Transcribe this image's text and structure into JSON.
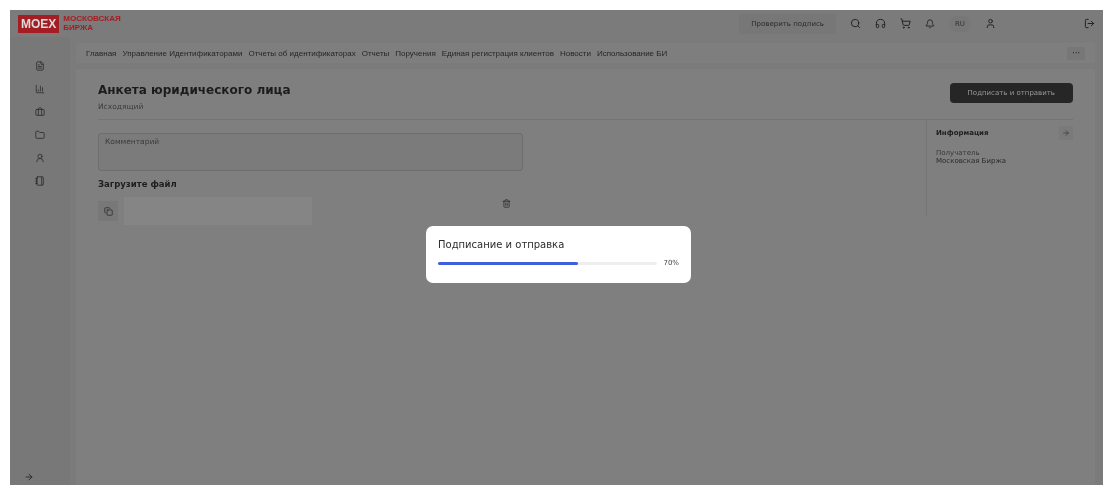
{
  "header": {
    "logo": "MOEX",
    "logo_caption": "МОСКОВСКАЯ БИРЖА",
    "verify_button": "Проверить подпись",
    "language": "RU"
  },
  "nav": {
    "items": [
      "Главная",
      "Управление Идентификаторами",
      "Отчеты об идентификаторах",
      "Отчеты",
      "Поручения",
      "Единая регистрация клиентов",
      "Новости",
      "Использование БИ"
    ],
    "more": "···"
  },
  "document": {
    "title": "Анкета юридического лица",
    "subtitle": "Исходящий",
    "submit_button": "Подписать и отправить",
    "comment": {
      "placeholder": "Комментарий"
    },
    "upload_title": "Загрузите файл"
  },
  "info": {
    "title": "Информация",
    "recipient_label": "Получатель",
    "recipient": "Московская Биржа"
  },
  "modal": {
    "title": "Подписание и отправка",
    "level": 0.64,
    "reading": "70%"
  }
}
